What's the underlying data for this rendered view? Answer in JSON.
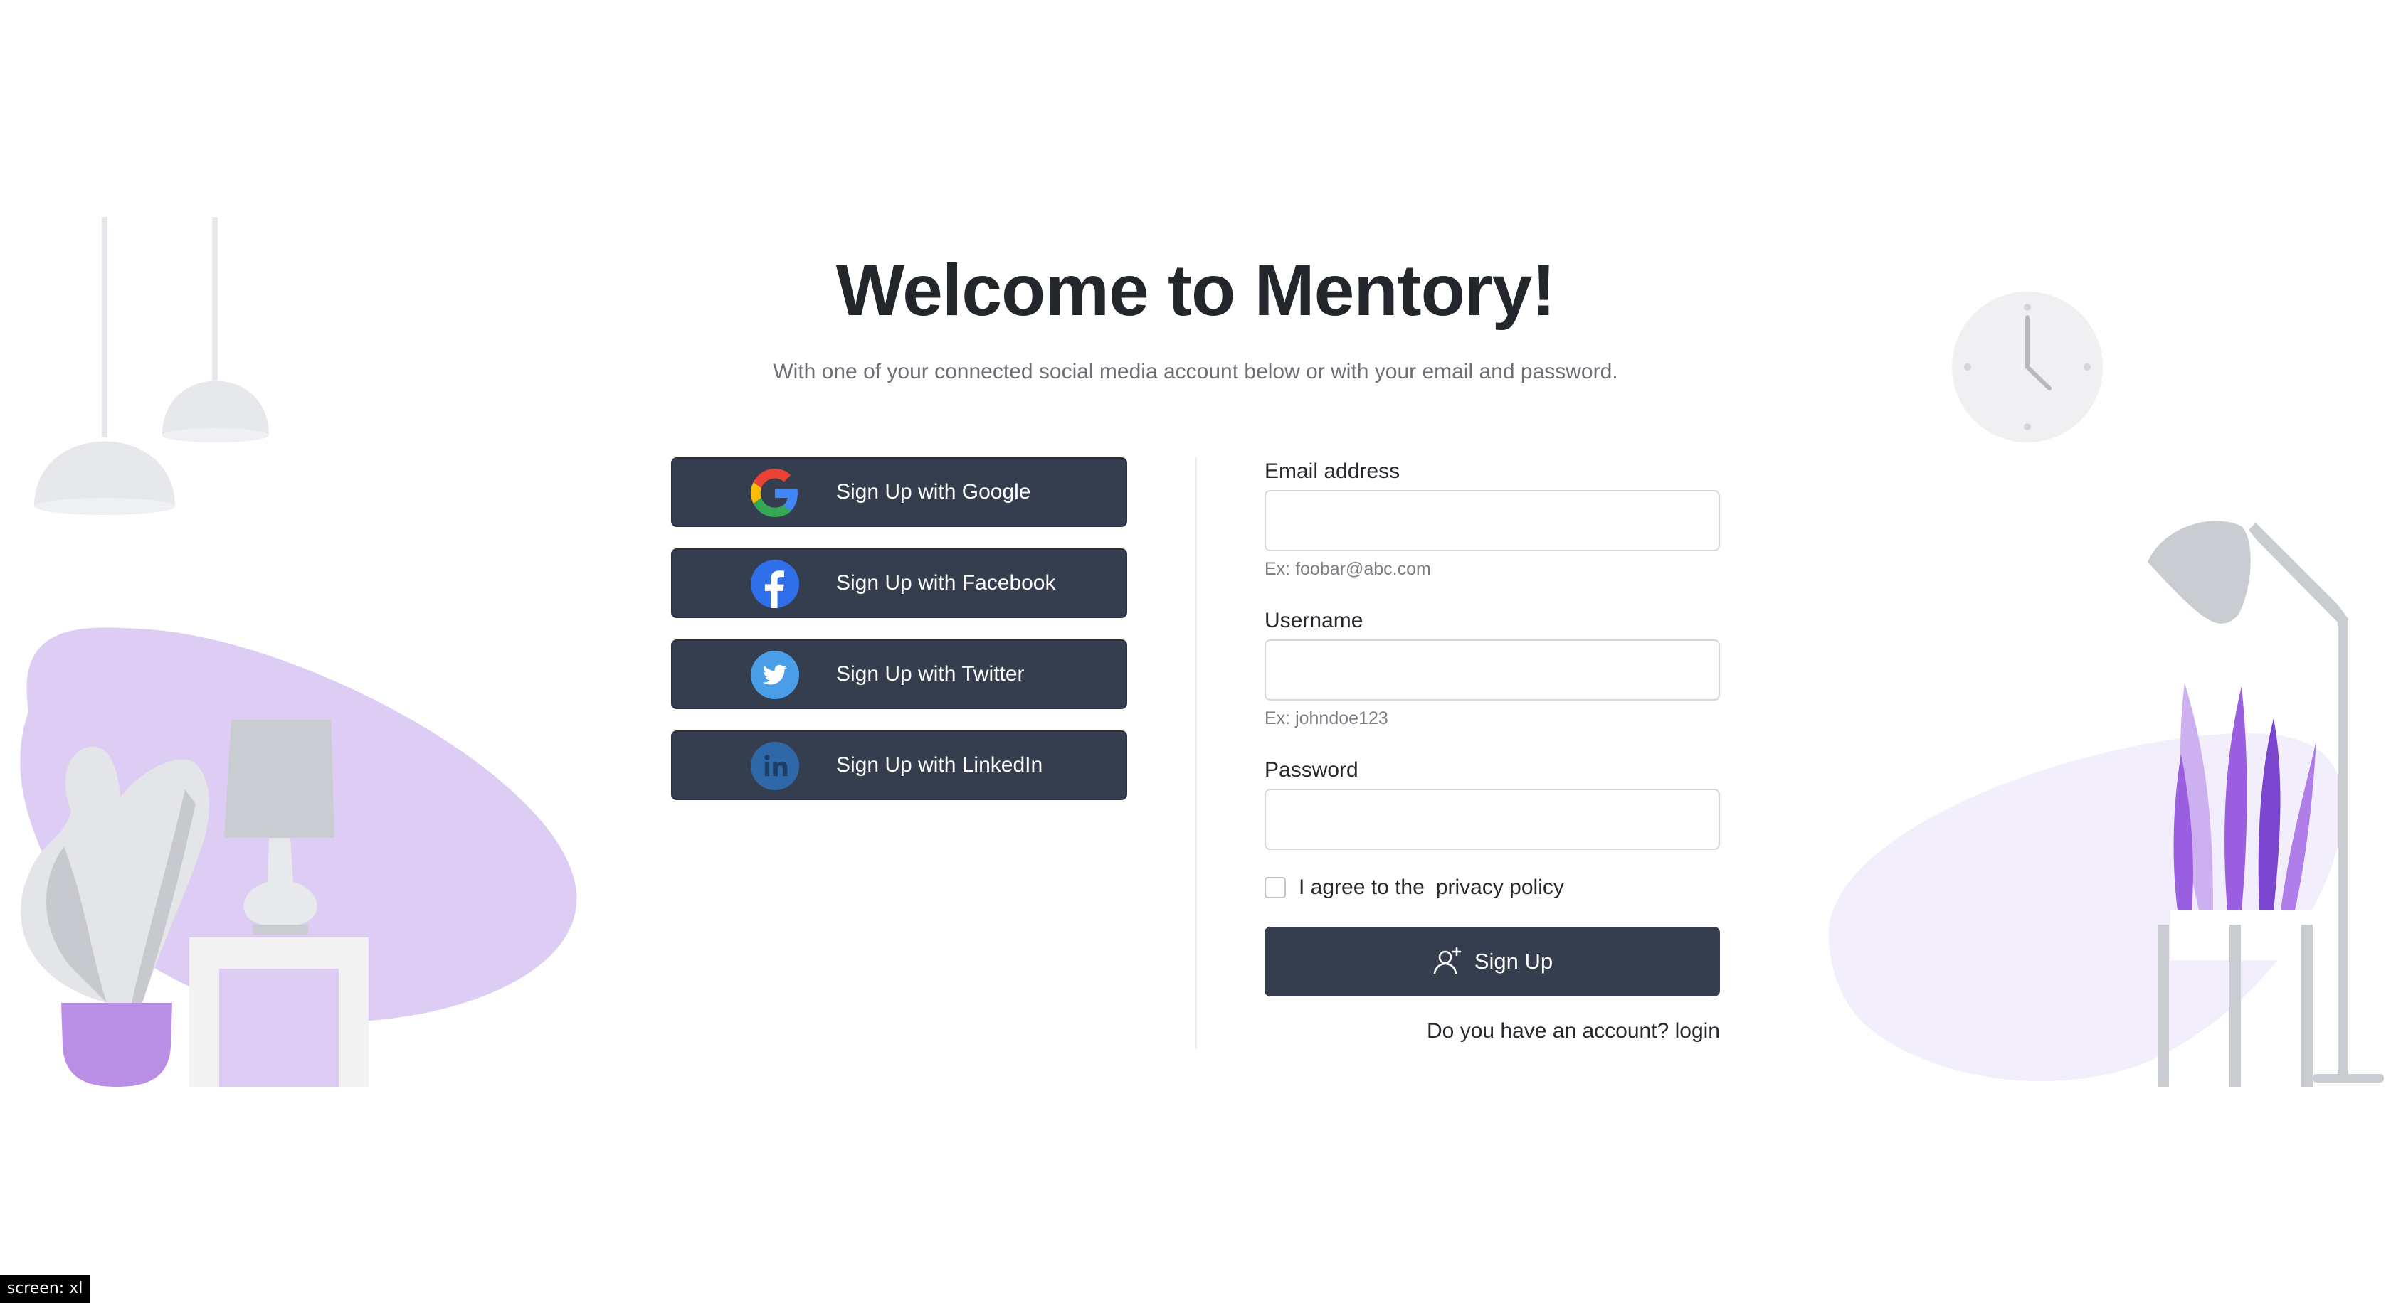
{
  "header": {
    "title": "Welcome to Mentory!",
    "subtitle": "With one of your connected social media account below or with your email and password."
  },
  "social": {
    "items": [
      {
        "label": "Sign Up with Google",
        "icon": "google-icon"
      },
      {
        "label": "Sign Up with Facebook",
        "icon": "facebook-icon"
      },
      {
        "label": "Sign Up with Twitter",
        "icon": "twitter-icon"
      },
      {
        "label": "Sign Up with LinkedIn",
        "icon": "linkedin-icon"
      }
    ]
  },
  "form": {
    "email": {
      "label": "Email address",
      "value": "",
      "hint": "Ex: foobar@abc.com"
    },
    "username": {
      "label": "Username",
      "value": "",
      "hint": "Ex: johndoe123"
    },
    "password": {
      "label": "Password",
      "value": ""
    },
    "agree": {
      "text": "I agree to the",
      "link": "privacy policy",
      "checked": false
    },
    "submit_label": "Sign Up",
    "submit_icon": "user-plus-icon",
    "login_prompt": "Do you have an account?",
    "login_link": "login"
  },
  "screen_tag": "screen: xl",
  "colors": {
    "button_bg": "#353e4e",
    "accent_purple": "#b98fe6",
    "blob_light": "#ddcdf4",
    "illustration_gray": "#e6e8ec"
  }
}
